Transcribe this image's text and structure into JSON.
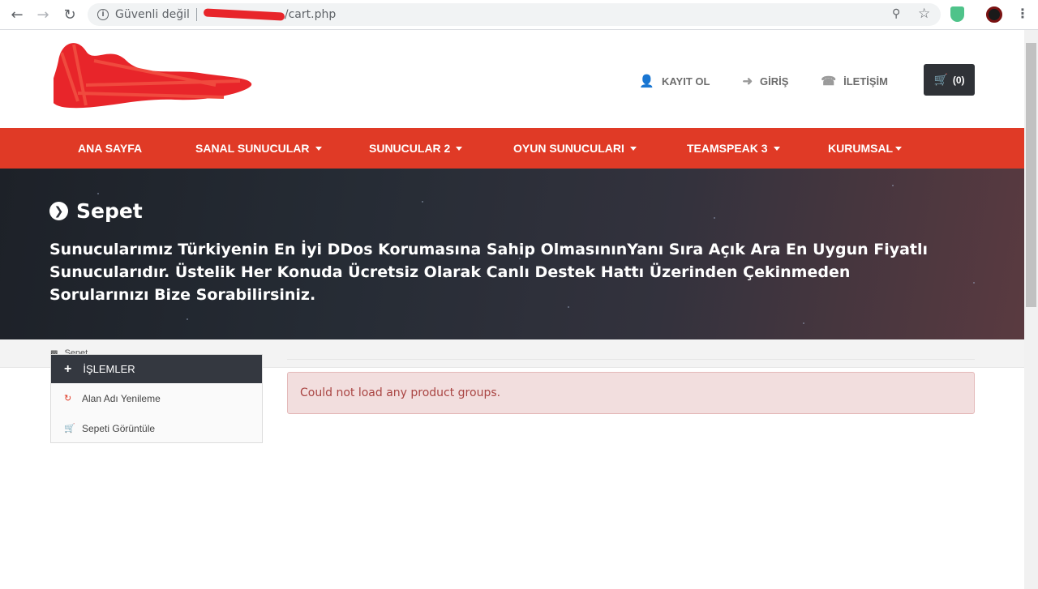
{
  "browser": {
    "security_label": "Güvenli değil",
    "url_path": "/cart.php"
  },
  "header": {
    "links": [
      {
        "label": "KAYIT OL",
        "icon": "user-plus-icon"
      },
      {
        "label": "GİRİŞ",
        "icon": "sign-in-icon"
      },
      {
        "label": "İLETİŞİM",
        "icon": "phone-icon"
      }
    ],
    "cart_label": "(0)"
  },
  "nav": {
    "items": [
      {
        "label": "ANA SAYFA",
        "dropdown": false
      },
      {
        "label": "SANAL SUNUCULAR",
        "dropdown": true
      },
      {
        "label": "SUNUCULAR 2",
        "dropdown": true
      },
      {
        "label": "OYUN SUNUCULARI",
        "dropdown": true
      },
      {
        "label": "TEAMSPEAK 3",
        "dropdown": true
      },
      {
        "label": "KURUMSAL",
        "dropdown": true
      }
    ]
  },
  "hero": {
    "title": "Sepet",
    "text": "Sunucularımız Türkiyenin En İyi DDos Korumasına Sahip OlmasınınYanı Sıra Açık Ara En Uygun Fiyatlı Sunucularıdır. Üstelik Her Konuda Ücretsiz Olarak Canlı Destek Hattı Üzerinden Çekinmeden Sorularınızı Bize Sorabilirsiniz."
  },
  "breadcrumb": {
    "current": "Sepet"
  },
  "sidebar": {
    "title": "İŞLEMLER",
    "items": [
      {
        "label": "Alan Adı Yenileme",
        "icon": "refresh-icon"
      },
      {
        "label": "Sepeti Görüntüle",
        "icon": "cart-icon"
      }
    ]
  },
  "alert": {
    "message": "Could not load any product groups."
  },
  "colors": {
    "brand_red": "#e03a26",
    "dark": "#343840",
    "alert_bg": "#f2dede",
    "alert_text": "#a94442"
  }
}
